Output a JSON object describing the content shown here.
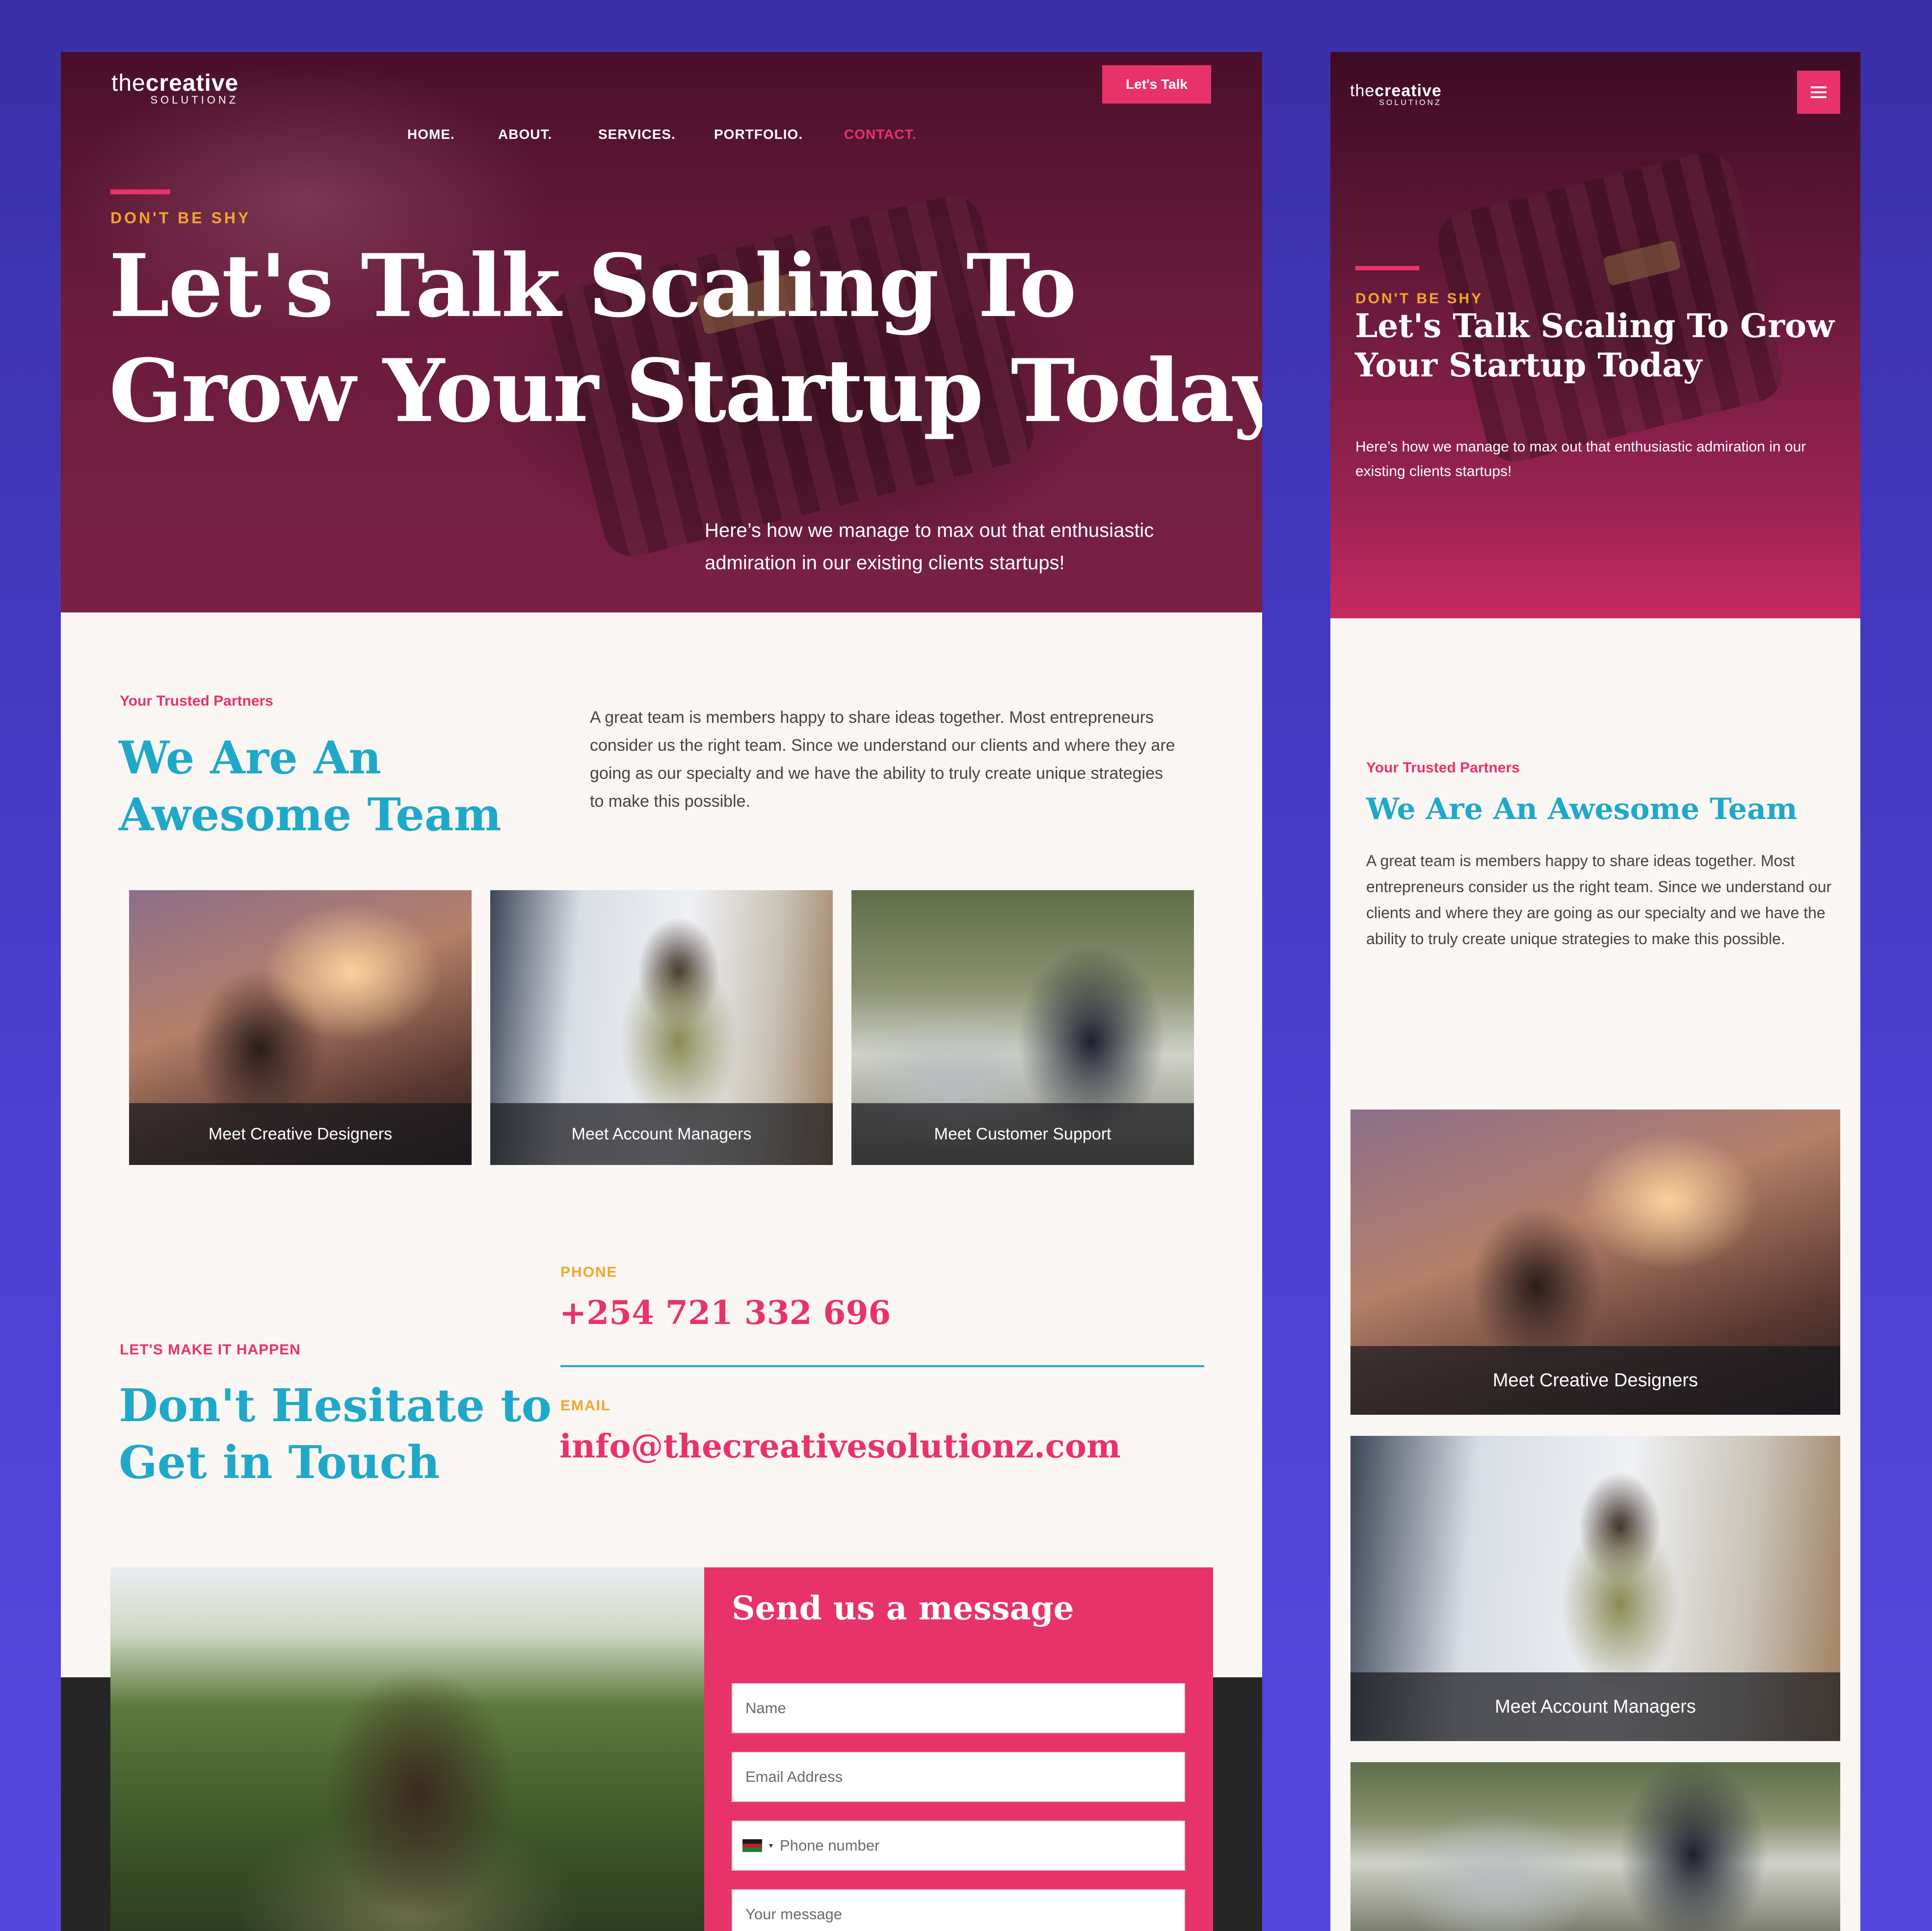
{
  "brand": {
    "logo_the": "the",
    "logo_creative": "creative",
    "logo_sub": "SOLUTIONZ"
  },
  "desktop": {
    "nav": [
      {
        "label": "HOME."
      },
      {
        "label": "ABOUT."
      },
      {
        "label": "SERVICES."
      },
      {
        "label": "PORTFOLIO."
      },
      {
        "label": "CONTACT.",
        "active": true
      }
    ],
    "cta_button": "Let's Talk",
    "hero": {
      "eyebrow": "DON'T BE SHY",
      "title_line1": "Let's Talk Scaling To",
      "title_line2": "Grow Your Startup Today",
      "text": "Here’s how we manage to max out that enthusiastic admiration in our existing clients startups!"
    },
    "team": {
      "label": "Your Trusted Partners",
      "heading_line1": "We Are An",
      "heading_line2": "Awesome Team",
      "copy": "A great team is members happy to share ideas together. Most entrepreneurs consider us the right team. Since we understand our clients and where they are going as our specialty and we have the ability to truly create unique strategies to make this possible.",
      "cards": [
        {
          "label": "Meet Creative Designers"
        },
        {
          "label": "Meet Account Managers"
        },
        {
          "label": "Meet Customer Support"
        }
      ]
    },
    "contact": {
      "label": "LET'S MAKE IT HAPPEN",
      "heading_line1": "Don't Hesitate to",
      "heading_line2": "Get in Touch",
      "phone_label": "PHONE",
      "phone_value": "+254 721 332 696",
      "email_label": "EMAIL",
      "email_value": "info@thecreativesolutionz.com"
    },
    "form": {
      "title": "Send us a message",
      "name_placeholder": "Name",
      "email_placeholder": "Email Address",
      "phone_placeholder": "Phone number",
      "message_placeholder": "Your message"
    }
  },
  "mobile": {
    "hero": {
      "eyebrow": "DON'T BE SHY",
      "title_line1": "Let's Talk Scaling To Grow",
      "title_line2": "Your Startup Today",
      "text": "Here’s how we manage to max out that enthusiastic admiration in our existing clients startups!"
    },
    "team": {
      "label": "Your Trusted Partners",
      "heading": "We Are An Awesome Team",
      "copy": "A great team is members happy to share ideas together. Most entrepreneurs consider us the right team. Since we understand our clients and where they are going as our specialty and we have the ability to truly create unique strategies to make this possible.",
      "cards": [
        {
          "label": "Meet Creative Designers"
        },
        {
          "label": "Meet Account Managers"
        }
      ]
    }
  },
  "icons": {
    "menu": "hamburger-menu-icon",
    "flag": "kenya-flag-icon",
    "caret": "chevron-down-icon"
  },
  "colors": {
    "accent_pink": "#e8336a",
    "accent_teal": "#1fa8c9",
    "accent_gold": "#f4a52b",
    "page_bg": "#4a3fd0",
    "dark_band": "#262626"
  }
}
